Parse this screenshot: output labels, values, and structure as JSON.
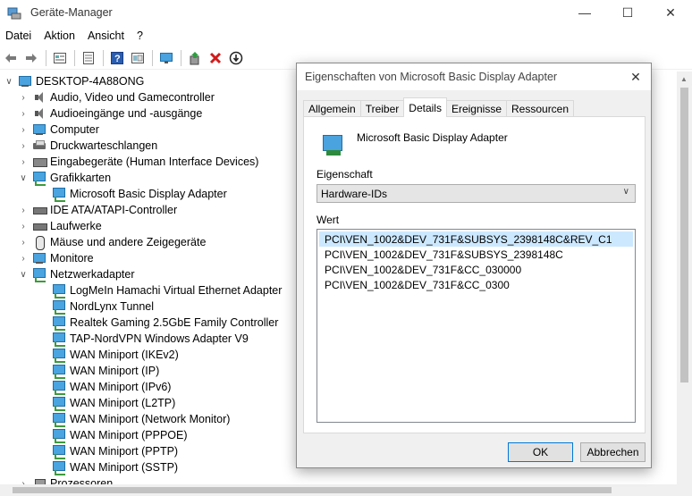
{
  "window": {
    "title": "Geräte-Manager",
    "controls": {
      "minimize": "—",
      "maximize": "☐",
      "close": "✕"
    }
  },
  "menu": [
    "Datei",
    "Aktion",
    "Ansicht",
    "?"
  ],
  "toolbar": {
    "icons": [
      "back-icon",
      "forward-icon",
      "properties-icon",
      "show-hidden-icon",
      "help-icon",
      "view-icon",
      "monitor-icon",
      "update-driver-icon",
      "uninstall-icon",
      "disable-icon"
    ]
  },
  "tree": {
    "root": "DESKTOP-4A88ONG",
    "categories": [
      {
        "label": "Audio, Video und Gamecontroller",
        "expanded": false,
        "icon": "speaker-icon"
      },
      {
        "label": "Audioeingänge und -ausgänge",
        "expanded": false,
        "icon": "speaker-icon"
      },
      {
        "label": "Computer",
        "expanded": false,
        "icon": "computer-icon"
      },
      {
        "label": "Druckwarteschlangen",
        "expanded": false,
        "icon": "printer-icon"
      },
      {
        "label": "Eingabegeräte (Human Interface Devices)",
        "expanded": false,
        "icon": "hid-icon"
      },
      {
        "label": "Grafikkarten",
        "expanded": true,
        "icon": "display-adapter-icon",
        "children": [
          "Microsoft Basic Display Adapter"
        ]
      },
      {
        "label": "IDE ATA/ATAPI-Controller",
        "expanded": false,
        "icon": "ide-controller-icon"
      },
      {
        "label": "Laufwerke",
        "expanded": false,
        "icon": "drive-icon"
      },
      {
        "label": "Mäuse und andere Zeigegeräte",
        "expanded": false,
        "icon": "mouse-icon"
      },
      {
        "label": "Monitore",
        "expanded": false,
        "icon": "monitor-icon"
      },
      {
        "label": "Netzwerkadapter",
        "expanded": true,
        "icon": "network-adapter-icon",
        "children": [
          "LogMeIn Hamachi Virtual Ethernet Adapter",
          "NordLynx Tunnel",
          "Realtek Gaming 2.5GbE Family Controller",
          "TAP-NordVPN Windows Adapter V9",
          "WAN Miniport (IKEv2)",
          "WAN Miniport (IP)",
          "WAN Miniport (IPv6)",
          "WAN Miniport (L2TP)",
          "WAN Miniport (Network Monitor)",
          "WAN Miniport (PPPOE)",
          "WAN Miniport (PPTP)",
          "WAN Miniport (SSTP)"
        ]
      },
      {
        "label": "Prozessoren",
        "expanded": false,
        "icon": "processor-icon"
      }
    ]
  },
  "dialog": {
    "title": "Eigenschaften von Microsoft Basic Display Adapter",
    "close": "✕",
    "tabs": [
      "Allgemein",
      "Treiber",
      "Details",
      "Ereignisse",
      "Ressourcen"
    ],
    "active_tab": "Details",
    "device_name": "Microsoft Basic Display Adapter",
    "property_label": "Eigenschaft",
    "property_value": "Hardware-IDs",
    "value_label": "Wert",
    "values": [
      "PCI\\VEN_1002&DEV_731F&SUBSYS_2398148C&REV_C1",
      "PCI\\VEN_1002&DEV_731F&SUBSYS_2398148C",
      "PCI\\VEN_1002&DEV_731F&CC_030000",
      "PCI\\VEN_1002&DEV_731F&CC_0300"
    ],
    "selected_value_index": 0,
    "ok": "OK",
    "cancel": "Abbrechen"
  }
}
